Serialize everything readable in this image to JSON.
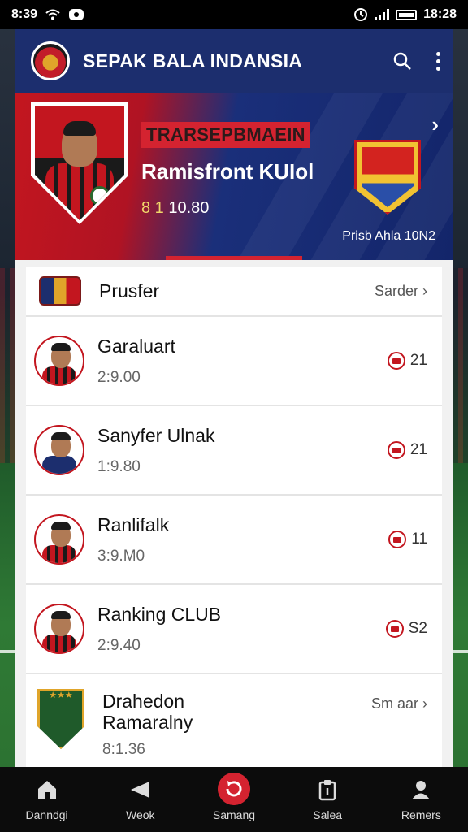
{
  "status_bar": {
    "time_left": "8:39",
    "time_right": "18:28"
  },
  "header": {
    "title": "SEPAK BALA INDANSIA",
    "search_icon": "search-icon",
    "more_icon": "more-vertical-icon"
  },
  "banner": {
    "tag": "TRARSEPBMAEIN",
    "name": "Ramisfront KUIol",
    "value_prefix": "8 1",
    "value_rest": " 10.80",
    "caption": "Prisb Ahla 10N2",
    "colors": {
      "red": "#c3161f",
      "navy": "#1a2f7a"
    }
  },
  "list": {
    "header_item": {
      "title": "Prusfer",
      "action": "Sarder"
    },
    "players": [
      {
        "name": "Garaluart",
        "meta": "2:9.00",
        "rank": "21"
      },
      {
        "name": "Sanyfer Ulnak",
        "meta": "1:9.80",
        "rank": "21"
      },
      {
        "name": "Ranlifalk",
        "meta": "3:9.M0",
        "rank": "11"
      },
      {
        "name": "Ranking CLUB",
        "meta": "2:9.40",
        "rank": "S2"
      }
    ],
    "club_item": {
      "title_line1": "Drahedon",
      "title_line2": "Ramaralny",
      "meta": "8:1.36",
      "action": "Sm aar"
    }
  },
  "bottom_nav": [
    {
      "label": "Danndgi",
      "icon": "home-icon"
    },
    {
      "label": "Weok",
      "icon": "megaphone-icon"
    },
    {
      "label": "Samang",
      "icon": "refresh-icon"
    },
    {
      "label": "Salea",
      "icon": "clipboard-icon"
    },
    {
      "label": "Remers",
      "icon": "person-icon"
    }
  ]
}
